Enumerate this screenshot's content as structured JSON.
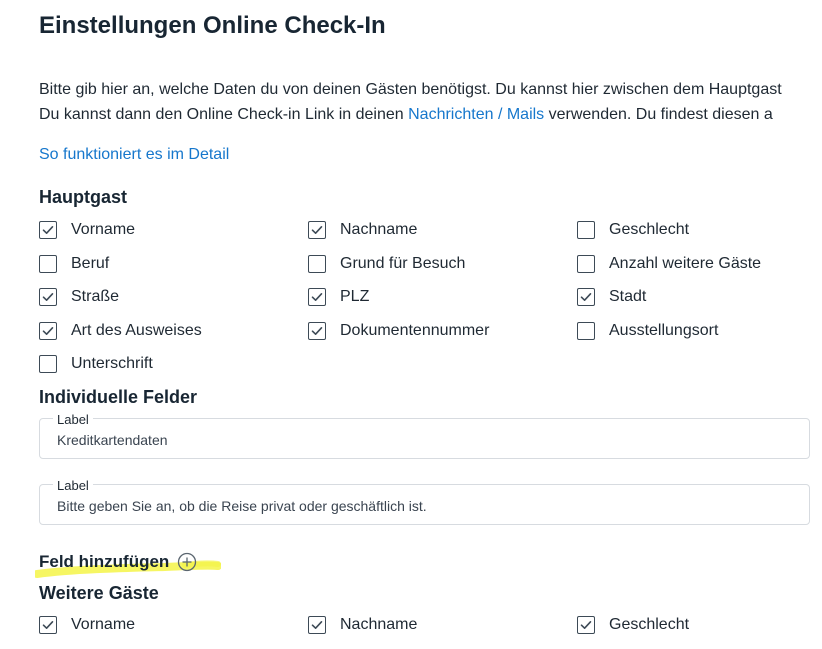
{
  "page": {
    "title": "Einstellungen Online Check-In"
  },
  "intro": {
    "line1": "Bitte gib hier an, welche Daten du von deinen Gästen benötigst. Du kannst hier zwischen dem Hauptgast",
    "line2_before": "Du kannst dann den Online Check-in Link in deinen ",
    "line2_link": "Nachrichten / Mails",
    "line2_after": " verwenden. Du findest diesen a"
  },
  "detail_link": "So funktioniert es im Detail",
  "colors": {
    "link": "#1677cc",
    "text": "#1f2933",
    "highlight": "#f5f54a"
  },
  "main_guest": {
    "title": "Hauptgast",
    "rows": [
      [
        {
          "label": "Vorname",
          "checked": true
        },
        {
          "label": "Nachname",
          "checked": true
        },
        {
          "label": "Geschlecht",
          "checked": false
        }
      ],
      [
        {
          "label": "Beruf",
          "checked": false
        },
        {
          "label": "Grund für Besuch",
          "checked": false
        },
        {
          "label": "Anzahl weitere Gäste",
          "checked": false
        }
      ],
      [
        {
          "label": "Straße",
          "checked": true
        },
        {
          "label": "PLZ",
          "checked": true
        },
        {
          "label": "Stadt",
          "checked": true
        }
      ],
      [
        {
          "label": "Art des Ausweises",
          "checked": true
        },
        {
          "label": "Dokumentennummer",
          "checked": true
        },
        {
          "label": "Ausstellungsort",
          "checked": false
        }
      ],
      [
        {
          "label": "Unterschrift",
          "checked": false
        }
      ]
    ]
  },
  "custom_fields": {
    "title": "Individuelle Felder",
    "fields": [
      {
        "label": "Label",
        "value": "Kreditkartendaten"
      },
      {
        "label": "Label",
        "value": "Bitte geben Sie an, ob die Reise privat oder geschäftlich ist."
      }
    ],
    "add_label": "Feld hinzufügen",
    "add_icon": "plus-circle-icon"
  },
  "other_guests": {
    "title": "Weitere Gäste",
    "rows": [
      [
        {
          "label": "Vorname",
          "checked": true
        },
        {
          "label": "Nachname",
          "checked": true
        },
        {
          "label": "Geschlecht",
          "checked": true
        }
      ]
    ]
  }
}
